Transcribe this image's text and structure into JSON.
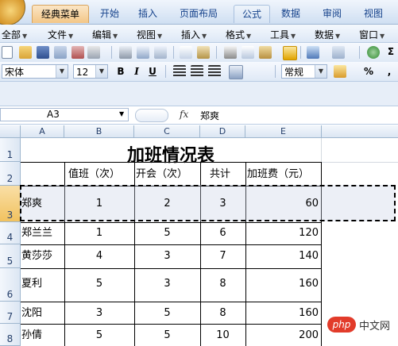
{
  "ribbon_tabs": [
    "经典菜单",
    "开始",
    "插入",
    "页面布局",
    "公式",
    "数据",
    "审阅",
    "视图"
  ],
  "menus": [
    "全部",
    "文件",
    "编辑",
    "视图",
    "插入",
    "格式",
    "工具",
    "数据",
    "窗口"
  ],
  "font": {
    "name": "宋体",
    "size": "12",
    "bold": "B",
    "italic": "I",
    "underline": "U",
    "number_format": "常规",
    "percent": "%",
    "comma": ","
  },
  "sigma_label": "Σ",
  "name_box": "A3",
  "formula_value": "郑爽",
  "columns": [
    "A",
    "B",
    "C",
    "D",
    "E"
  ],
  "rows": [
    "1",
    "2",
    "3",
    "4",
    "5",
    "6",
    "7",
    "8"
  ],
  "sheet": {
    "title": "加班情况表",
    "headers": [
      "值班（次）",
      "开会（次）",
      "共计",
      "加班费（元）"
    ],
    "records": [
      {
        "name": "郑爽",
        "duty": "1",
        "meeting": "2",
        "total": "3",
        "pay": "60"
      },
      {
        "name": "郑兰兰",
        "duty": "1",
        "meeting": "5",
        "total": "6",
        "pay": "120"
      },
      {
        "name": "黄莎莎",
        "duty": "4",
        "meeting": "3",
        "total": "7",
        "pay": "140"
      },
      {
        "name": "夏利",
        "duty": "5",
        "meeting": "3",
        "total": "8",
        "pay": "160"
      },
      {
        "name": "沈阳",
        "duty": "3",
        "meeting": "5",
        "total": "8",
        "pay": "160"
      },
      {
        "name": "孙倩",
        "duty": "5",
        "meeting": "5",
        "total": "10",
        "pay": "200"
      }
    ]
  },
  "watermark": {
    "logo": "php",
    "text": "中文网"
  }
}
